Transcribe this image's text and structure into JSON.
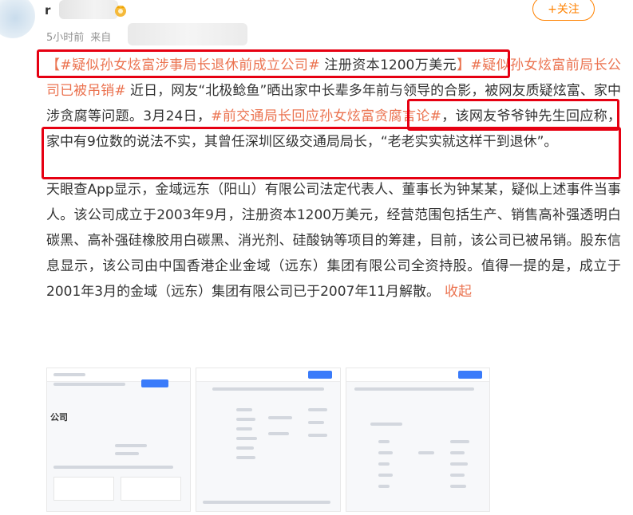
{
  "header": {
    "username": "r",
    "time": "5小时前",
    "source_prefix": "来自",
    "follow_label": "+关注"
  },
  "post": {
    "tag1": "【#疑似孙女炫富涉事局长退休前成立公司#",
    "text1": " 注册资本1200万美元",
    "tag2_open": "】#疑似孙女炫富前局长公司已被吊销#",
    "text2": " 近日，网友“北极鲶鱼”晒出家中长辈多年前与领导的合影，被网友质疑炫富、家中涉贪腐等问题。3月24日，",
    "tag3": "#前交通局长回应孙女炫富贪腐言论#",
    "text3": "，该网友爷爷钟先生回应称，家中有9位数的说法不实，其曾任深圳区级交通局局长，“老老实实就这样干到退休”。",
    "para2": "天眼查App显示，金域远东（阳山）有限公司法定代表人、董事长为钟某某，疑似上述事件当事人。该公司成立于2003年9月，注册资本1200万美元，经营范围包括生产、销售高补强透明白碳黑、高补强硅橡胶用白碳黑、消光剂、硅酸钠等项目的筹建，目前，该公司已被吊销。股东信息显示，该公司由中国香港企业金域（远东）集团有限公司全资持股。值得一提的是，成立于2001年3月的金域（远东）集团有限公司已于2007年11月解散。",
    "collapse_label": "收起"
  },
  "images": {
    "img1_title": "公司"
  },
  "colors": {
    "accent": "#eb7350",
    "follow": "#ff8200",
    "highlight_box": "#e60012",
    "text": "#333333",
    "meta": "#939393"
  }
}
